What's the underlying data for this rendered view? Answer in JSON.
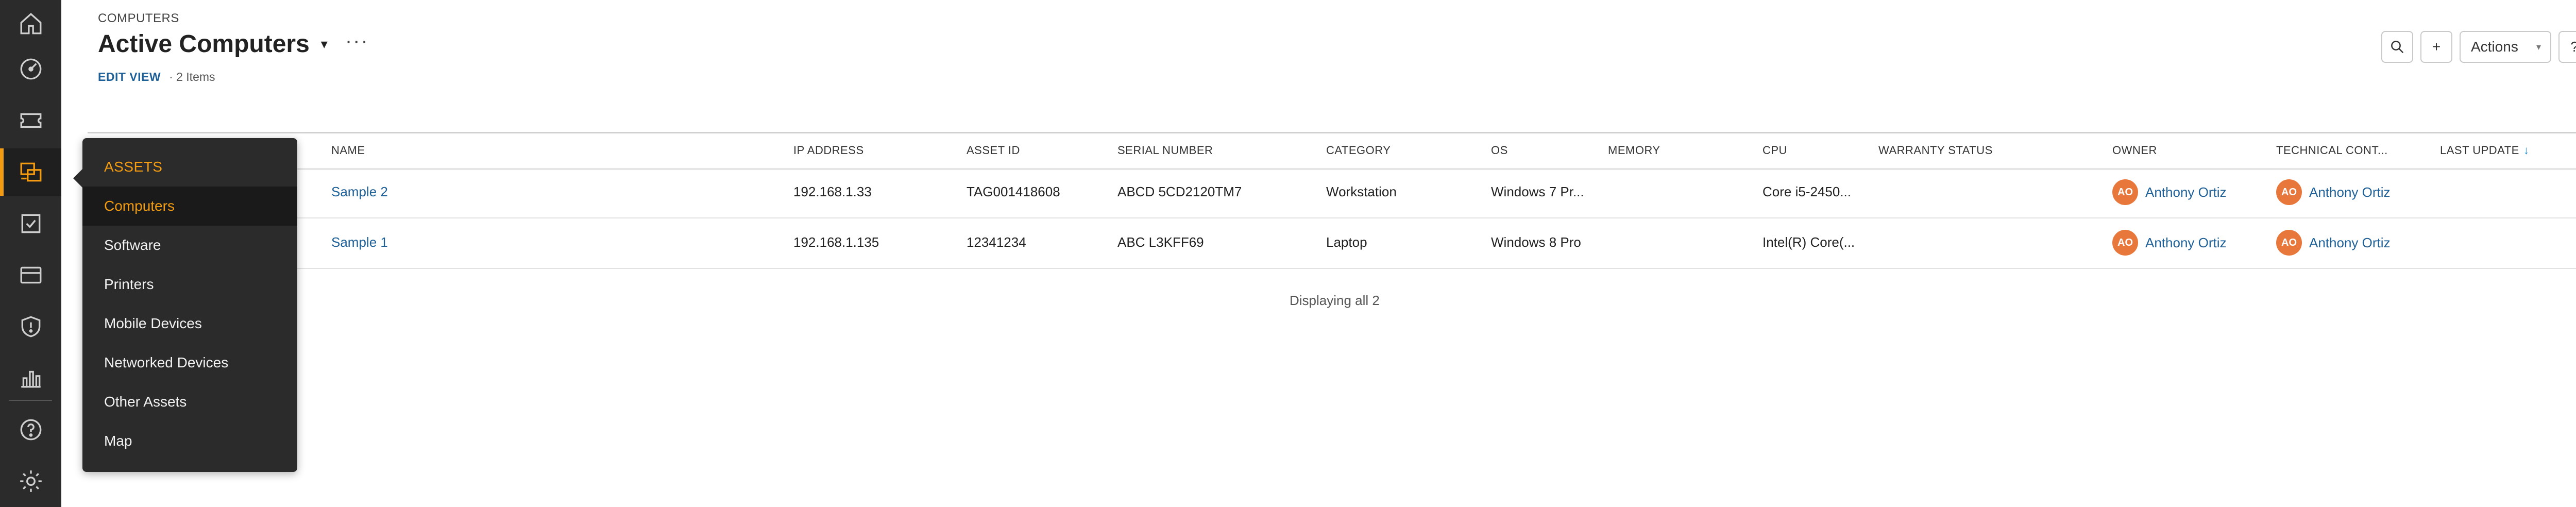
{
  "rail": {
    "items": [
      {
        "icon": "home-icon"
      },
      {
        "icon": "dashboard-icon"
      },
      {
        "icon": "ticket-icon"
      },
      {
        "icon": "assets-icon",
        "active": true
      },
      {
        "icon": "tasks-icon"
      },
      {
        "icon": "card-icon"
      },
      {
        "icon": "shield-icon"
      },
      {
        "icon": "analytics-icon"
      },
      {
        "icon": "help-icon"
      },
      {
        "icon": "settings-icon"
      }
    ]
  },
  "header": {
    "breadcrumb": "COMPUTERS",
    "title": "Active Computers",
    "caret": "▾",
    "more": "···",
    "edit_view": "EDIT VIEW",
    "items_count": "· 2 Items"
  },
  "toolbar": {
    "search_icon": "search-icon",
    "add_label": "+",
    "actions_label": "Actions",
    "actions_arrow": "▾",
    "help_label": "?"
  },
  "table": {
    "columns": [
      "NAME",
      "IP ADDRESS",
      "ASSET ID",
      "SERIAL NUMBER",
      "CATEGORY",
      "OS",
      "MEMORY",
      "CPU",
      "WARRANTY STATUS",
      "OWNER",
      "TECHNICAL CONT...",
      "LAST UPDATE"
    ],
    "sort_arrow": "↓",
    "rows": [
      {
        "name": "Sample 2",
        "ip": "192.168.1.33",
        "asset_id": "TAG001418608",
        "serial": "ABCD 5CD2120TM7",
        "category": "Workstation",
        "os": "Windows 7 Pr...",
        "memory": "",
        "cpu": "Core i5-2450...",
        "warranty": "",
        "owner_initials": "AO",
        "owner": "Anthony Ortiz",
        "tech_initials": "AO",
        "tech": "Anthony Ortiz",
        "last_update": ""
      },
      {
        "name": "Sample 1",
        "ip": "192.168.1.135",
        "asset_id": "12341234",
        "serial": "ABC L3KFF69",
        "category": "Laptop",
        "os": "Windows 8 Pro",
        "memory": "",
        "cpu": "Intel(R) Core(...",
        "warranty": "",
        "owner_initials": "AO",
        "owner": "Anthony Ortiz",
        "tech_initials": "AO",
        "tech": "Anthony Ortiz",
        "last_update": ""
      }
    ],
    "footer": "Displaying all 2"
  },
  "menu": {
    "header": "ASSETS",
    "items": [
      "Computers",
      "Software",
      "Printers",
      "Mobile Devices",
      "Networked Devices",
      "Other Assets",
      "Map"
    ],
    "selected": "Computers"
  },
  "colors": {
    "accent": "#f39c12",
    "link": "#1d5f97",
    "avatar": "#e8773b",
    "rail": "#2b2b2b"
  }
}
